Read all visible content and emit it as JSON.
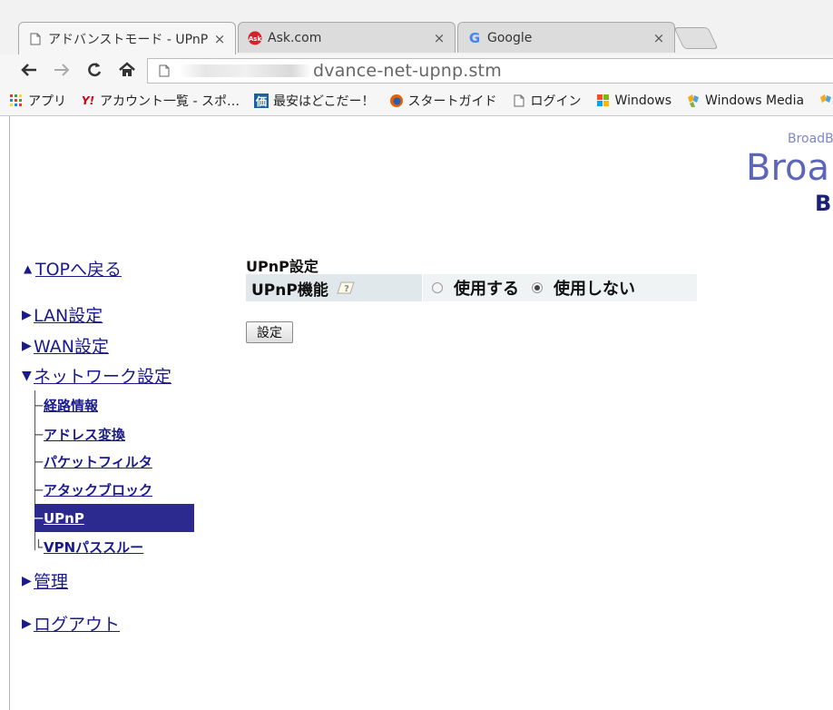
{
  "browser": {
    "tabs": [
      {
        "title": "アドバンストモード - UPnP",
        "close": "×",
        "active": true,
        "icon": "page-icon"
      },
      {
        "title": "Ask.com",
        "close": "×",
        "active": false,
        "icon": "ask-icon"
      },
      {
        "title": "Google",
        "close": "×",
        "active": false,
        "icon": "google-icon"
      }
    ],
    "url_visible": "dvance-net-upnp.stm",
    "bookmarks": [
      {
        "label": "アプリ",
        "icon": "apps-grid-icon"
      },
      {
        "label": "アカウント一覧 - スポ…",
        "icon": "yahoo-icon"
      },
      {
        "label": "最安はどこだー！",
        "icon": "kakaku-icon"
      },
      {
        "label": "スタートガイド",
        "icon": "firefox-icon"
      },
      {
        "label": "ログイン",
        "icon": "page-icon"
      },
      {
        "label": "Windows",
        "icon": "windows-icon"
      },
      {
        "label": "Windows Media",
        "icon": "windows-media-icon"
      }
    ]
  },
  "header": {
    "brand_small": "BroadB",
    "brand_big": "Broa",
    "brand_b": "B"
  },
  "nav": {
    "top": "TOPへ戻る",
    "lan": "LAN設定",
    "wan": "WAN設定",
    "network": "ネットワーク設定",
    "sub": [
      {
        "label": "経路情報"
      },
      {
        "label": "アドレス変換"
      },
      {
        "label": "パケットフィルタ"
      },
      {
        "label": "アタックブロック"
      },
      {
        "label": "UPnP",
        "selected": true
      },
      {
        "label": "VPNパススルー"
      }
    ],
    "admin": "管理",
    "logout": "ログアウト"
  },
  "main": {
    "section_title": "UPnP設定",
    "function_label": "UPnP機能",
    "option_use": "使用する",
    "option_nouse": "使用しない",
    "selected_option": "使用しない",
    "submit": "設定"
  },
  "colors": {
    "nav_link": "#1a1a8c",
    "nav_selected_bg": "#2d2a8f",
    "label_cell": "#e1e8ec",
    "brand": "#5d66b8"
  }
}
